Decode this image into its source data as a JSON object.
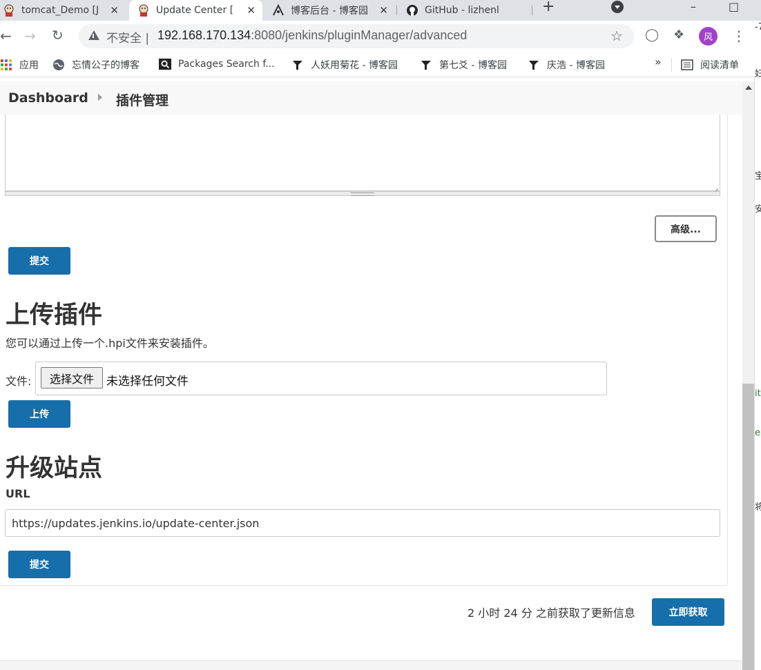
{
  "browser": {
    "tabs": [
      {
        "label": "tomcat_Demo [J",
        "icon": "jenkins-icon",
        "active": false
      },
      {
        "label": "Update Center [",
        "icon": "jenkins-icon",
        "active": true
      },
      {
        "label": "博客后台 - 博客园",
        "icon": "cnblogs-icon",
        "active": false
      },
      {
        "label": "GitHub - lizhenl",
        "icon": "github-icon",
        "active": false
      }
    ],
    "tab_close_glyph": "✕",
    "new_tab_glyph": "+",
    "address": {
      "insecure_label": "不安全 |",
      "host": "192.168.170.134",
      "path": ":8080/jenkins/pluginManager/advanced"
    },
    "avatar_letter": "风",
    "bookmarks": [
      {
        "label": "应用",
        "icon": "apps-icon"
      },
      {
        "label": "忘情公子的博客",
        "icon": "globe-icon"
      },
      {
        "label": "Packages Search f...",
        "icon": "search-icon"
      },
      {
        "label": "人妖用菊花 - 博客园",
        "icon": "cnblogs-icon"
      },
      {
        "label": "第七爻 - 博客园",
        "icon": "cnblogs-icon"
      },
      {
        "label": "庆浩 - 博客园",
        "icon": "cnblogs-icon"
      }
    ],
    "bookmarks_more": "»",
    "reading_list": "阅读清单"
  },
  "breadcrumb": {
    "items": [
      "Dashboard",
      "插件管理"
    ]
  },
  "proxy_section": {
    "advanced_button": "高级...",
    "submit_button": "提交"
  },
  "upload_section": {
    "title": "上传插件",
    "description": "您可以通过上传一个.hpi文件来安装插件。",
    "file_label": "文件:",
    "choose_button": "选择文件",
    "no_file_text": "未选择任何文件",
    "upload_button": "上传"
  },
  "update_site_section": {
    "title": "升级站点",
    "url_label": "URL",
    "url_value": "https://updates.jenkins.io/update-center.json",
    "submit_button": "提交"
  },
  "footer": {
    "status_text": "2 小时 24 分 之前获取了更新信息",
    "check_now_button": "立即获取"
  },
  "edge_fragments": [
    "-7",
    "妇",
    "宝",
    "安",
    "it",
    "e",
    "将"
  ],
  "colors": {
    "primary_button": "#166eaa",
    "avatar": "#a142c7",
    "tab_strip": "#dee1e6"
  }
}
